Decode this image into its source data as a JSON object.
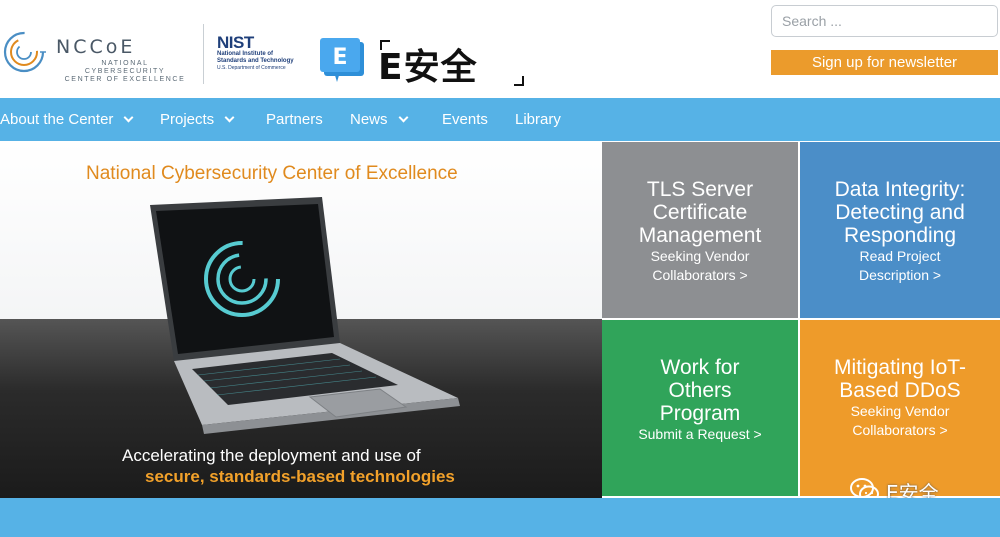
{
  "header": {
    "nccoe_logo": {
      "word": "NCCoE",
      "sub_line1": "NATIONAL CYBERSECURITY",
      "sub_line2": "CENTER OF EXCELLENCE"
    },
    "nist_logo": {
      "word": "NIST",
      "line1": "National Institute of",
      "line2": "Standards and Technology",
      "line3": "U.S. Department of Commerce"
    },
    "esecurity_logo": {
      "badge": "E",
      "title": "E安全"
    },
    "search": {
      "placeholder": "Search ..."
    },
    "newsletter_label": "Sign up for newsletter"
  },
  "nav": {
    "items": [
      {
        "label": "About the Center",
        "has_dropdown": true
      },
      {
        "label": "Projects",
        "has_dropdown": true
      },
      {
        "label": "Partners",
        "has_dropdown": false
      },
      {
        "label": "News",
        "has_dropdown": true
      },
      {
        "label": "Events",
        "has_dropdown": false
      },
      {
        "label": "Library",
        "has_dropdown": false
      }
    ]
  },
  "hero": {
    "title": "National Cybersecurity Center of Excellence",
    "tagline_line1": "Accelerating the deployment and use of",
    "tagline_line2": "secure, standards-based technologies"
  },
  "tiles": [
    {
      "title_lines": [
        "TLS Server",
        "Certificate",
        "Management"
      ],
      "sub_lines": [
        "Seeking Vendor",
        "Collaborators >"
      ],
      "color": "#8d8f92"
    },
    {
      "title_lines": [
        "Data Integrity:",
        "Detecting and",
        "Responding"
      ],
      "sub_lines": [
        "Read Project",
        "Description >"
      ],
      "color": "#4b8ec8"
    },
    {
      "title_lines": [
        "Work for",
        "Others",
        "Program"
      ],
      "sub_lines": [
        "Submit a Request >"
      ],
      "color": "#30a45a"
    },
    {
      "title_lines": [
        "Mitigating IoT-",
        "Based DDoS"
      ],
      "sub_lines": [
        "Seeking Vendor",
        "Collaborators >"
      ],
      "color": "#ee9b2a"
    }
  ],
  "watermark": {
    "text": "E安全",
    "icon": "wechat-icon"
  },
  "colors": {
    "nav_blue": "#56b2e6",
    "accent_orange": "#eb9b2c"
  }
}
